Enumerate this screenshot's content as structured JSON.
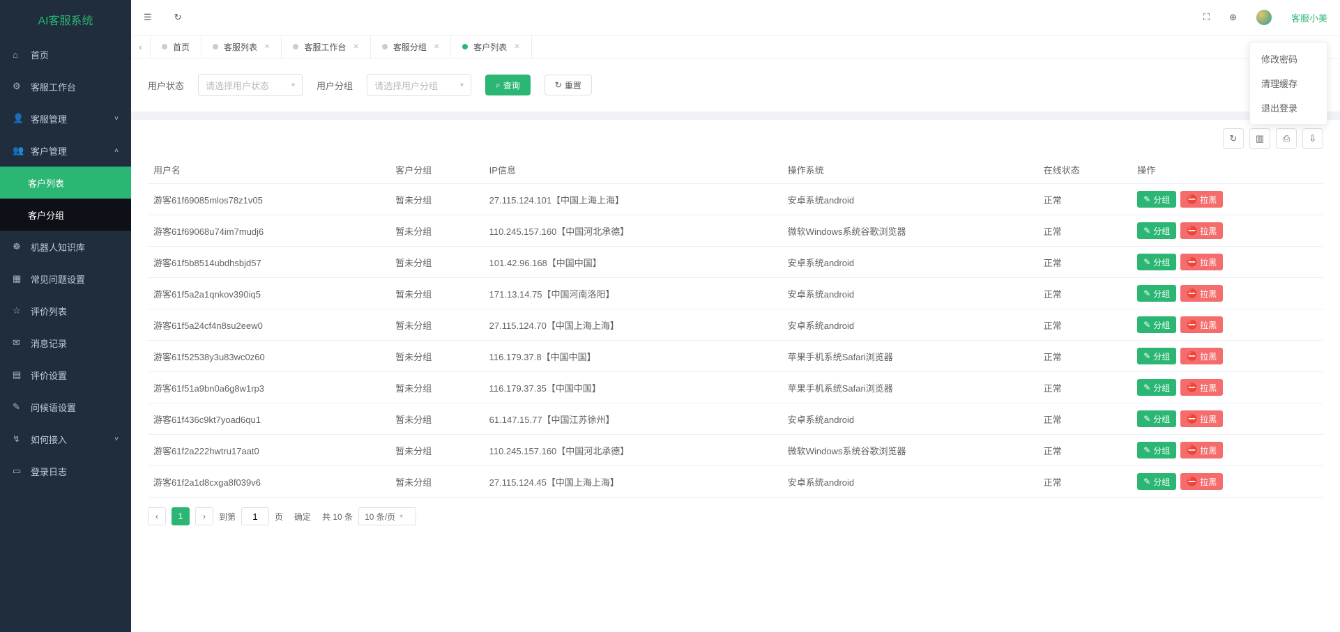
{
  "brand": "AI客服系统",
  "user": {
    "name": "客服小美"
  },
  "dropdown": {
    "change_password": "修改密码",
    "clear_cache": "清理缓存",
    "logout": "退出登录"
  },
  "sidebar": [
    {
      "id": "home",
      "label": "首页",
      "icon": "⌂"
    },
    {
      "id": "workbench",
      "label": "客服工作台",
      "icon": "⚙"
    },
    {
      "id": "agent-mgmt",
      "label": "客服管理",
      "icon": "👤",
      "expandable": true,
      "expanded": false
    },
    {
      "id": "customer-mgmt",
      "label": "客户管理",
      "icon": "👥",
      "expandable": true,
      "expanded": true
    },
    {
      "id": "customer-list",
      "label": "客户列表",
      "sub": true,
      "active": true
    },
    {
      "id": "customer-group",
      "label": "客户分组",
      "sub": true,
      "dark": true
    },
    {
      "id": "robot-kb",
      "label": "机器人知识库",
      "icon": "☸"
    },
    {
      "id": "faq",
      "label": "常见问题设置",
      "icon": "▦"
    },
    {
      "id": "reviews",
      "label": "评价列表",
      "icon": "☆"
    },
    {
      "id": "messages",
      "label": "消息记录",
      "icon": "✉"
    },
    {
      "id": "review-settings",
      "label": "评价设置",
      "icon": "▤"
    },
    {
      "id": "greeting",
      "label": "问候语设置",
      "icon": "✎"
    },
    {
      "id": "integration",
      "label": "如何接入",
      "icon": "↯",
      "expandable": true,
      "expanded": false
    },
    {
      "id": "login-log",
      "label": "登录日志",
      "icon": "▭"
    }
  ],
  "tabs": [
    {
      "id": "home",
      "label": "首页",
      "closable": false
    },
    {
      "id": "agent-list",
      "label": "客服列表",
      "closable": true
    },
    {
      "id": "workbench",
      "label": "客服工作台",
      "closable": true
    },
    {
      "id": "agent-group",
      "label": "客服分组",
      "closable": true
    },
    {
      "id": "customer-list",
      "label": "客户列表",
      "closable": true,
      "active": true
    }
  ],
  "filters": {
    "status_label": "用户状态",
    "status_placeholder": "请选择用户状态",
    "group_label": "用户分组",
    "group_placeholder": "请选择用户分组",
    "query_btn": "查询",
    "reset_btn": "重置"
  },
  "table": {
    "columns": [
      "用户名",
      "客户分组",
      "IP信息",
      "操作系统",
      "在线状态",
      "操作"
    ],
    "actions": {
      "group": "分组",
      "block": "拉黑"
    },
    "rows": [
      {
        "username": "游客61f69085mlos78z1v05",
        "group": "暂未分组",
        "ip": "27.115.124.101【中国上海上海】",
        "os": "安卓系统android",
        "status": "正常"
      },
      {
        "username": "游客61f69068u74im7mudj6",
        "group": "暂未分组",
        "ip": "110.245.157.160【中国河北承德】",
        "os": "微软Windows系统谷歌浏览器",
        "status": "正常"
      },
      {
        "username": "游客61f5b8514ubdhsbjd57",
        "group": "暂未分组",
        "ip": "101.42.96.168【中国中国】",
        "os": "安卓系统android",
        "status": "正常"
      },
      {
        "username": "游客61f5a2a1qnkov390iq5",
        "group": "暂未分组",
        "ip": "171.13.14.75【中国河南洛阳】",
        "os": "安卓系统android",
        "status": "正常"
      },
      {
        "username": "游客61f5a24cf4n8su2eew0",
        "group": "暂未分组",
        "ip": "27.115.124.70【中国上海上海】",
        "os": "安卓系统android",
        "status": "正常"
      },
      {
        "username": "游客61f52538y3u83wc0z60",
        "group": "暂未分组",
        "ip": "116.179.37.8【中国中国】",
        "os": "苹果手机系统Safari浏览器",
        "status": "正常"
      },
      {
        "username": "游客61f51a9bn0a6g8w1rp3",
        "group": "暂未分组",
        "ip": "116.179.37.35【中国中国】",
        "os": "苹果手机系统Safari浏览器",
        "status": "正常"
      },
      {
        "username": "游客61f436c9kt7yoad6qu1",
        "group": "暂未分组",
        "ip": "61.147.15.77【中国江苏徐州】",
        "os": "安卓系统android",
        "status": "正常"
      },
      {
        "username": "游客61f2a222hwtru17aat0",
        "group": "暂未分组",
        "ip": "110.245.157.160【中国河北承德】",
        "os": "微软Windows系统谷歌浏览器",
        "status": "正常"
      },
      {
        "username": "游客61f2a1d8cxga8f039v6",
        "group": "暂未分组",
        "ip": "27.115.124.45【中国上海上海】",
        "os": "安卓系统android",
        "status": "正常"
      }
    ]
  },
  "pagination": {
    "current": "1",
    "goto_label": "到第",
    "page_label": "页",
    "confirm": "确定",
    "total_text": "共 10 条",
    "per_page": "10 条/页"
  }
}
